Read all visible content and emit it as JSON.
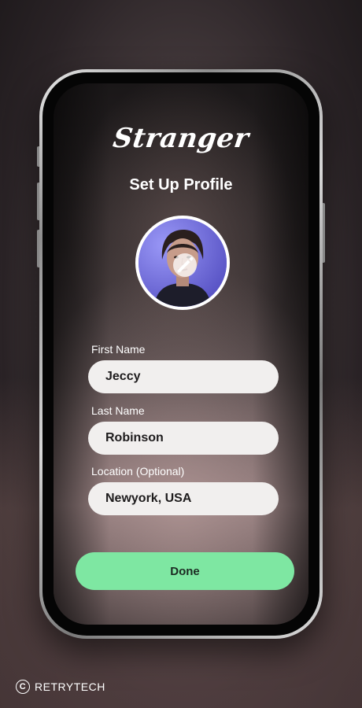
{
  "app": {
    "logo_text": "Stranger"
  },
  "page": {
    "title": "Set Up Profile"
  },
  "avatar": {
    "icon": "pencil-icon",
    "accent_color": "#6b67d9"
  },
  "form": {
    "first_name": {
      "label": "First Name",
      "value": "Jeccy"
    },
    "last_name": {
      "label": "Last Name",
      "value": "Robinson"
    },
    "location": {
      "label": "Location (Optional)",
      "value": "Newyork, USA"
    }
  },
  "actions": {
    "done_label": "Done",
    "done_color": "#7ee7a2"
  },
  "footer": {
    "brand": "RETRYTECH",
    "copyright_symbol": "C"
  }
}
